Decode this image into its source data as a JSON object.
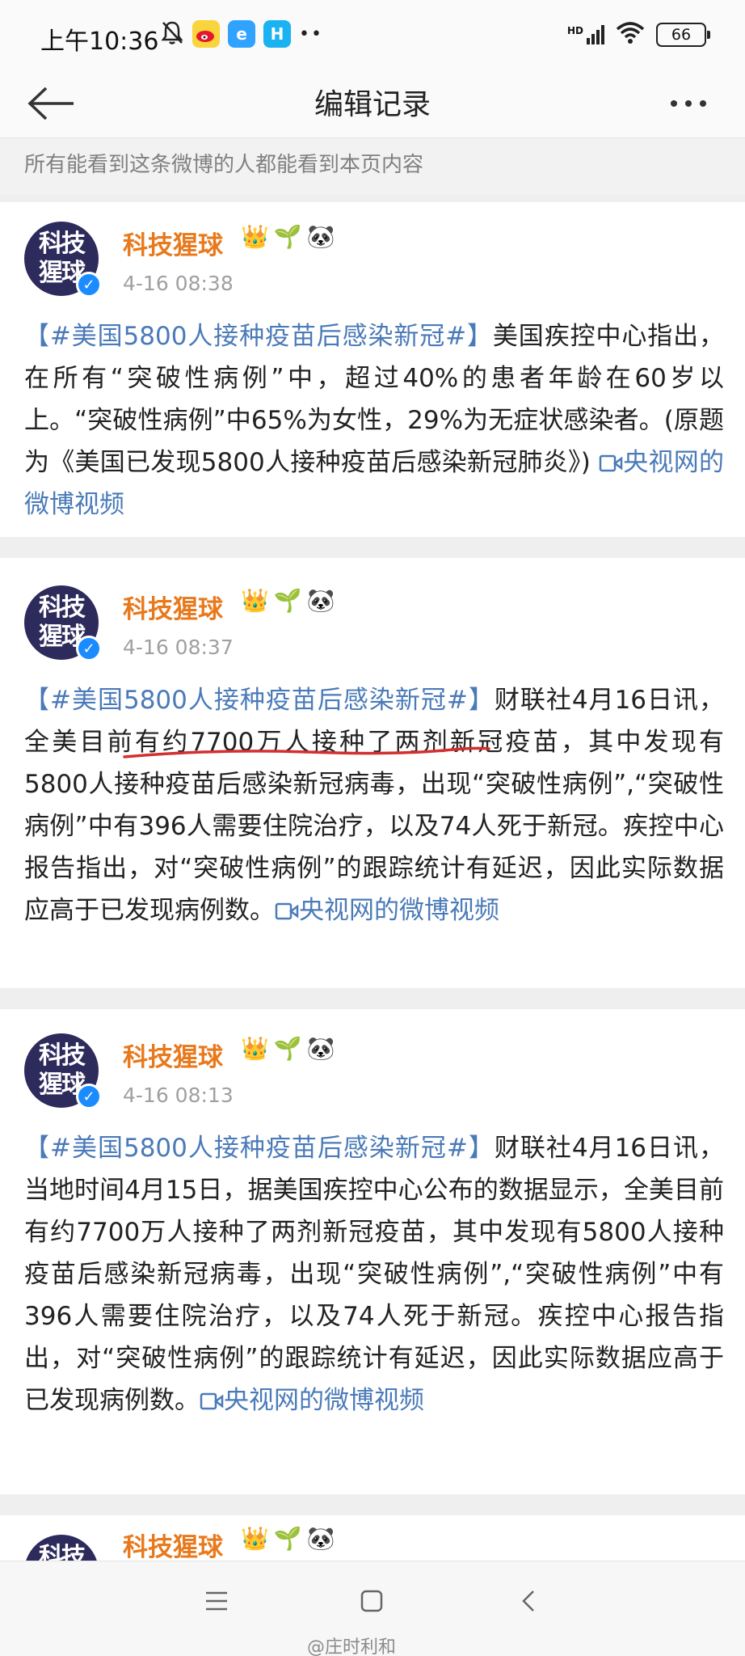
{
  "status": {
    "time": "上午10:36",
    "signal": "HD",
    "battery": "66"
  },
  "nav": {
    "title": "编辑记录"
  },
  "notice": "所有能看到这条微博的人都能看到本页内容",
  "avatar_text": [
    "科技",
    "猩球"
  ],
  "posts": [
    {
      "username": "科技猩球",
      "time": "4-16 08:38",
      "topic": "【#美国5800人接种疫苗后感染新冠#】",
      "body": "美国疾控中心指出，在所有“突破性病例”中，超过40%的患者年龄在60岁以上。“突破性病例”中65%为女性，29%为无症状感染者。(原题为《美国已发现5800人接种疫苗后感染新冠肺炎》) ",
      "video": "央视网的微博视频"
    },
    {
      "username": "科技猩球",
      "time": "4-16 08:37",
      "topic": "【#美国5800人接种疫苗后感染新冠#】",
      "body": "财联社4月16日讯，全美目前有约7700万人接种了两剂新冠疫苗，其中发现有5800人接种疫苗后感染新冠病毒，出现“突破性病例”,“突破性病例”中有396人需要住院治疗，以及74人死于新冠。疾控中心报告指出，对“突破性病例”的跟踪统计有延迟，因此实际数据应高于已发现病例数。",
      "video": "央视网的微博视频"
    },
    {
      "username": "科技猩球",
      "time": "4-16 08:13",
      "topic": "【#美国5800人接种疫苗后感染新冠#】",
      "body": "财联社4月16日讯，当地时间4月15日，据美国疾控中心公布的数据显示，全美目前有约7700万人接种了两剂新冠疫苗，其中发现有5800人接种疫苗后感染新冠病毒，出现“突破性病例”,“突破性病例”中有396人需要住院治疗，以及74人死于新冠。疾控中心报告指出，对“突破性病例”的跟踪统计有延迟，因此实际数据应高于已发现病例数。",
      "video": "央视网的微博视频"
    },
    {
      "username": "科技猩球"
    }
  ],
  "watermark": "@庄时利和",
  "colors": {
    "username": "#e8791d",
    "link": "#4a7ab8",
    "underline": "#d32f2f",
    "avatar_bg": "#2d2a5c",
    "verified": "#1a8cff"
  },
  "icons": [
    "mute-bell-icon",
    "weibo-icon",
    "browser-icon",
    "app-h-icon",
    "wifi-icon",
    "back-arrow-icon",
    "more-icon",
    "crown-icon",
    "plant-icon",
    "panda-icon",
    "video-icon",
    "menu-icon",
    "home-icon",
    "back-icon"
  ]
}
